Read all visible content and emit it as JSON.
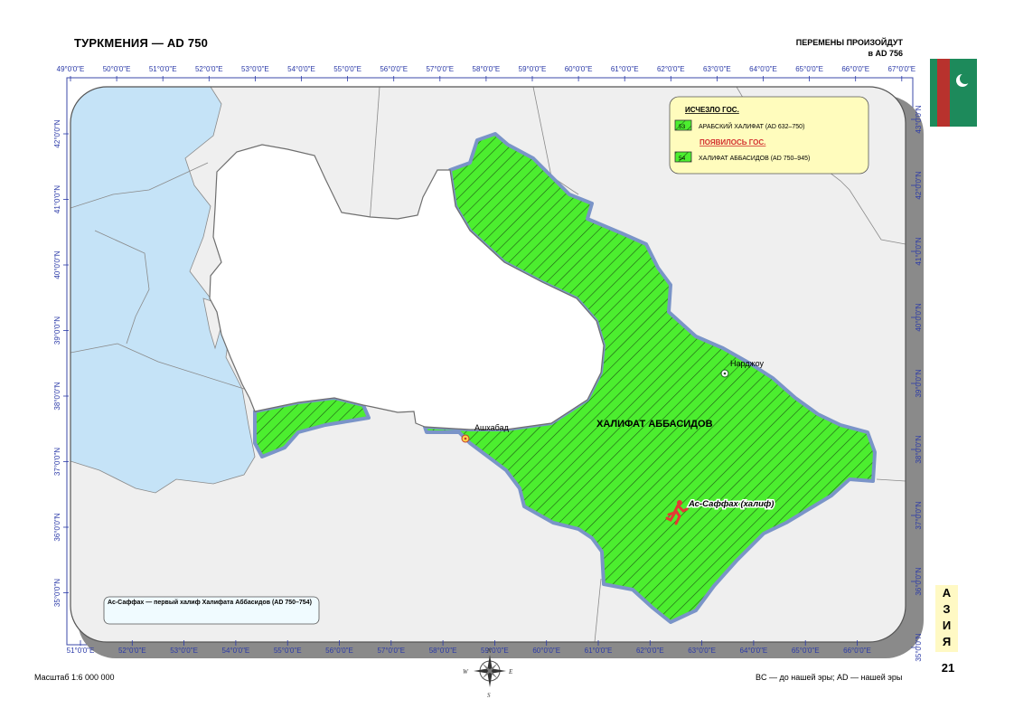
{
  "header": {
    "title": "ТУРКМЕНИЯ — AD 750",
    "changes_line1": "ПЕРЕМЕНЫ ПРОИЗОЙДУТ",
    "changes_line2": "в AD 756"
  },
  "legend": {
    "vanished_title": "ИСЧЕЗЛО ГОС.",
    "vanished_code": "53",
    "vanished_label": "АРАБСКИЙ ХАЛИФАТ (AD 632–750)",
    "appeared_title": "ПОЯВИЛОСЬ ГОС.",
    "appeared_code": "54",
    "appeared_label": "ХАЛИФАТ АББАСИДОВ (AD 750–945)"
  },
  "map": {
    "region_label": "ХАЛИФАТ АББАСИДОВ",
    "cities": [
      {
        "name": "Ашхабад"
      },
      {
        "name": "Нарджоу"
      }
    ],
    "person_label": "Ас-Саффах (халиф)",
    "note": "Ас-Саффах — первый халиф Халифата Аббасидов (AD 750–754)",
    "colors": {
      "sea": "#c5e3f7",
      "land": "#efefef",
      "state": "#4cee2f",
      "border": "#5a75b8",
      "legend_bg": "#fffcbd"
    }
  },
  "axes": {
    "top": [
      "49°0'0\"E",
      "50°0'0\"E",
      "51°0'0\"E",
      "52°0'0\"E",
      "53°0'0\"E",
      "54°0'0\"E",
      "55°0'0\"E",
      "56°0'0\"E",
      "57°0'0\"E",
      "58°0'0\"E",
      "59°0'0\"E",
      "60°0'0\"E",
      "61°0'0\"E",
      "62°0'0\"E",
      "63°0'0\"E",
      "64°0'0\"E",
      "65°0'0\"E",
      "66°0'0\"E",
      "67°0'0\"E"
    ],
    "bottom": [
      "51°0'0\"E",
      "52°0'0\"E",
      "53°0'0\"E",
      "54°0'0\"E",
      "55°0'0\"E",
      "56°0'0\"E",
      "57°0'0\"E",
      "58°0'0\"E",
      "59°0'0\"E",
      "60°0'0\"E",
      "61°0'0\"E",
      "62°0'0\"E",
      "63°0'0\"E",
      "64°0'0\"E",
      "65°0'0\"E",
      "66°0'0\"E"
    ],
    "left": [
      "42°0'0\"N",
      "41°0'0\"N",
      "40°0'0\"N",
      "39°0'0\"N",
      "38°0'0\"N",
      "37°0'0\"N",
      "36°0'0\"N",
      "35°0'0\"N"
    ],
    "right": [
      "43°0'0\"N",
      "42°0'0\"N",
      "41°0'0\"N",
      "40°0'0\"N",
      "39°0'0\"N",
      "38°0'0\"N",
      "37°0'0\"N",
      "36°0'0\"N",
      "35°0'0\"N"
    ]
  },
  "footer": {
    "scale": "Масштаб 1:6 000 000",
    "era_note": "BC — до нашей эры; AD — нашей эры",
    "section_letters": [
      "А",
      "З",
      "И",
      "Я"
    ],
    "page_number": "21",
    "compass_n": "N",
    "compass_s": "S",
    "compass_w": "W",
    "compass_e": "E"
  }
}
